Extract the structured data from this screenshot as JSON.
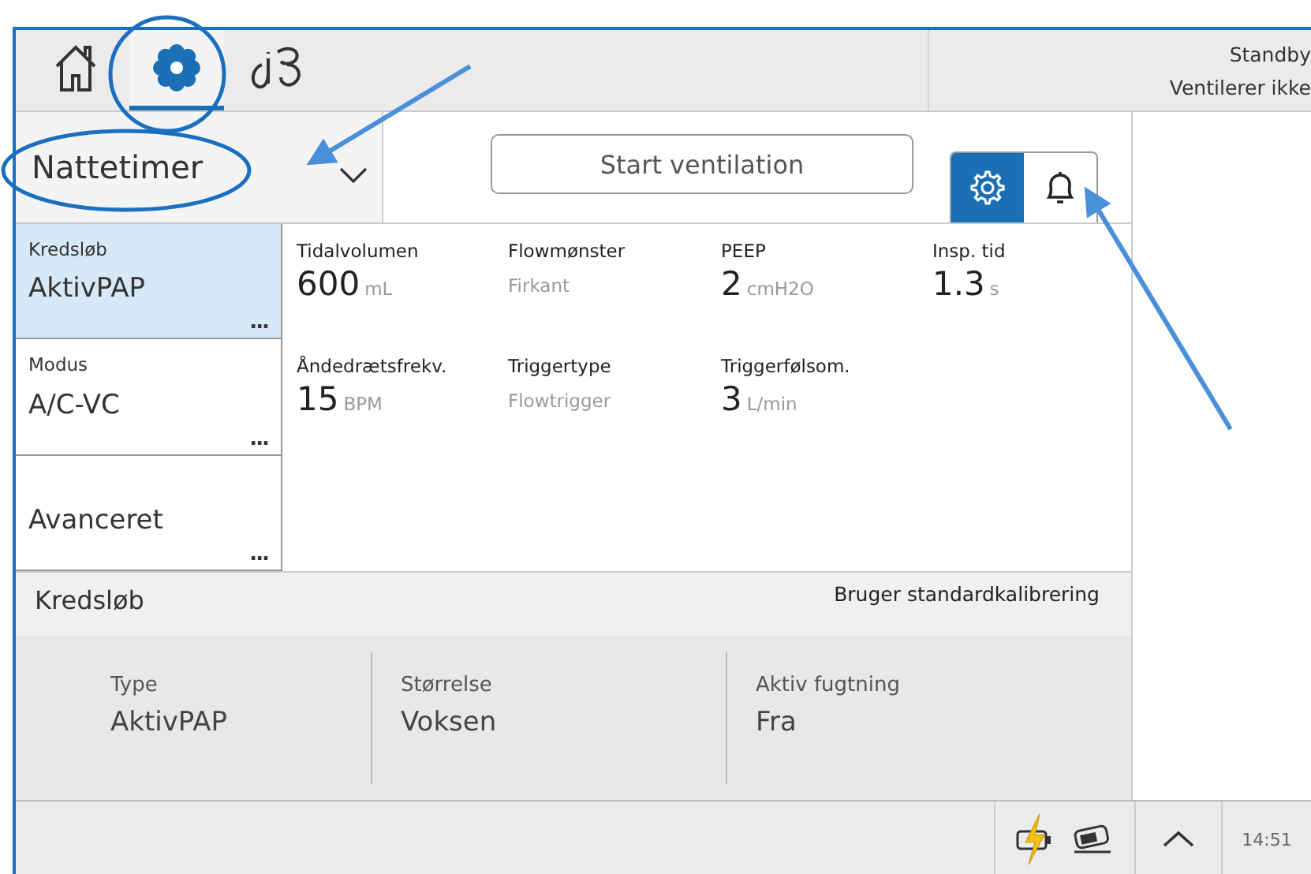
{
  "top_bar": {
    "tabs": [
      {
        "kind": "home",
        "selected": false
      },
      {
        "kind": "settings",
        "selected": true
      },
      {
        "kind": "tools",
        "selected": false
      }
    ],
    "status": [
      "Standby",
      "Ventilerer ikke"
    ]
  },
  "preset": {
    "value": "Nattetimer"
  },
  "start_button": "Start ventilation",
  "view_toggle": [
    {
      "kind": "settings",
      "selected": true
    },
    {
      "kind": "bell",
      "selected": false
    }
  ],
  "cards": [
    {
      "label": "Kredsløb",
      "value": "AktivPAP",
      "more": "...",
      "selected": true
    },
    {
      "label": "Modus",
      "value": "A/C-VC",
      "more": "...",
      "selected": false
    },
    {
      "value": "Avanceret",
      "more": "...",
      "selected": false
    }
  ],
  "parameters": [
    {
      "label": "Tidalvolumen",
      "value": "600",
      "unit": "mL",
      "kind": "number"
    },
    {
      "label": "Flowmønster",
      "value": "Firkant",
      "kind": "text"
    },
    {
      "label": "PEEP",
      "value": "2",
      "unit": "cmH2O",
      "kind": "number"
    },
    {
      "label": "Insp. tid",
      "value": "1.3",
      "unit": "s",
      "kind": "number"
    },
    {
      "label": "Åndedrætsfrekv.",
      "value": "15",
      "unit": "BPM",
      "kind": "number"
    },
    {
      "label": "Triggertype",
      "value": "Flowtrigger",
      "kind": "text"
    },
    {
      "label": "Triggerfølsom.",
      "value": "3",
      "unit": "L/min",
      "kind": "number"
    }
  ],
  "circuit": {
    "title": "Kredsløb",
    "note": "Bruger standardkalibrering",
    "fields": [
      {
        "label": "Type",
        "value": "AktivPAP"
      },
      {
        "label": "Størrelse",
        "value": "Voksen"
      },
      {
        "label": "Aktiv fugtning",
        "value": "Fra"
      }
    ]
  },
  "footer": {
    "time": "14:51"
  }
}
